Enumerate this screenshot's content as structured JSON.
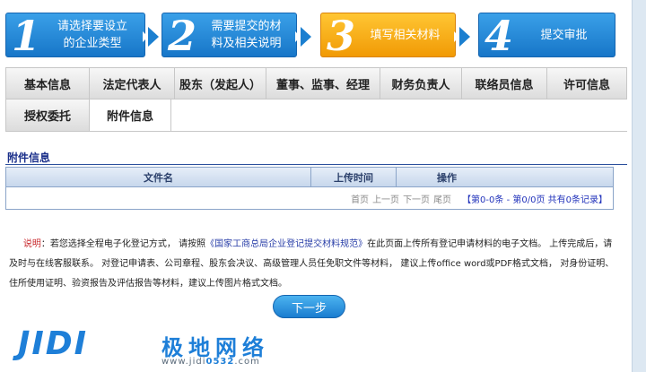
{
  "steps": [
    {
      "num": "1",
      "text": "请选择要设立\n的企业类型"
    },
    {
      "num": "2",
      "text": "需要提交的材\n料及相关说明"
    },
    {
      "num": "3",
      "text": "填写相关材料"
    },
    {
      "num": "4",
      "text": "提交审批"
    }
  ],
  "tabs_row1": [
    "基本信息",
    "法定代表人",
    "股东（发起人）",
    "董事、监事、经理",
    "财务负责人",
    "联络员信息",
    "许可信息"
  ],
  "tabs_row2": [
    "授权委托",
    "附件信息"
  ],
  "section": {
    "title": "附件信息"
  },
  "grid": {
    "columns": [
      "文件名",
      "上传时间",
      "操作"
    ],
    "pager": {
      "first": "首页",
      "prev": "上一页",
      "next": "下一页",
      "last": "尾页",
      "info": "【第0-0条 - 第0/0页 共有0条记录】"
    }
  },
  "notice": {
    "label": "说明",
    "part1": "：若您选择全程电子化登记方式， 请按照",
    "link": "《国家工商总局企业登记提交材料规范》",
    "part2": "在此页面上传所有登记申请材料的电子文档。 上传完成后，请及时与在线客服联系。 对登记申请表、公司章程、股东会决议、高级管理人员任免职文件等材料， 建议上传office word或PDF格式文档， 对身份证明、住所使用证明、验资报告及评估报告等材料，建议上传图片格式文档。"
  },
  "next_button": "下一步",
  "logo": {
    "mark": "JIDI",
    "cn": "极地网络",
    "url_pre": "www.jidi",
    "url_num": "0532",
    "url_post": ".com"
  },
  "colors": {
    "step_blue": "#1776c8",
    "step_active": "#f19a05",
    "title_navy": "#1a2f8a",
    "notice_red": "#c8262a"
  }
}
